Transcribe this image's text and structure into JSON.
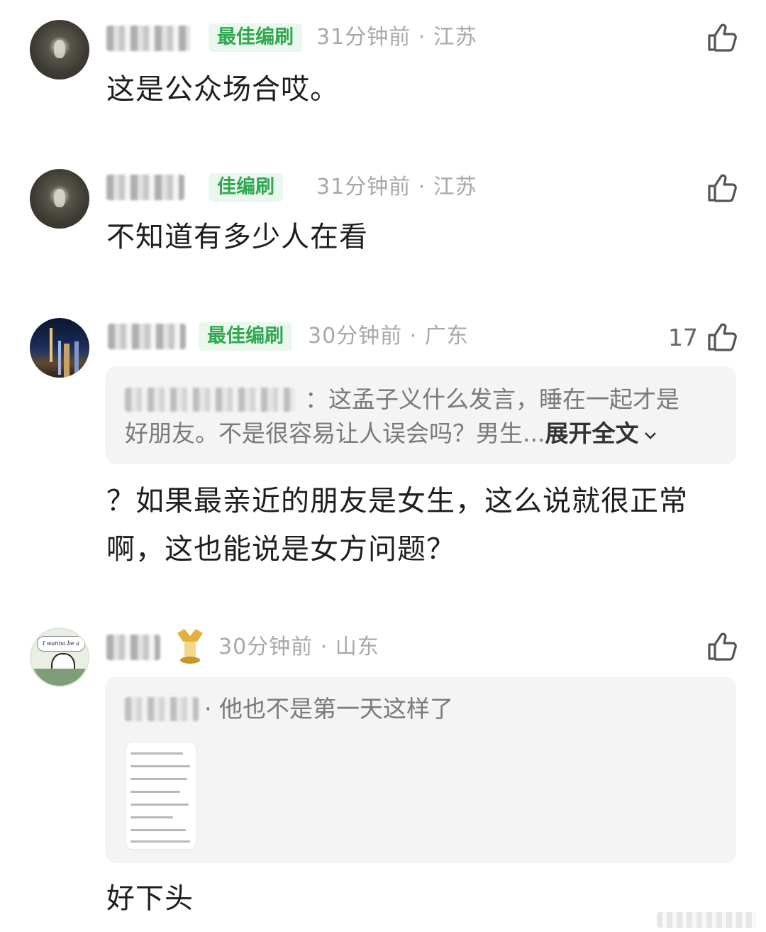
{
  "comments": [
    {
      "badge": "最佳编刷",
      "meta": "31分钟前 · 江苏",
      "text_lines": [
        "这是公众场合哎。"
      ]
    },
    {
      "badge": "佳编刷",
      "meta": "31分钟前 · 江苏",
      "text_lines": [
        "不知道有多少人在看"
      ]
    },
    {
      "badge": "最佳编刷",
      "meta": "30分钟前 · 广东",
      "like_count": "17",
      "quote_lines": [
        "：这孟子义什么发言，睡在一起才是",
        "好朋友。不是很容易让人误会吗？男生..."
      ],
      "quote_expand": "展开全文",
      "text_lines": [
        "？如果最亲近的朋友是女生，这么说就很正常",
        "啊，这也能说是女方问题？"
      ]
    },
    {
      "meta": "30分钟前 · 山东",
      "avatar_caption": "I wanna be a fish.",
      "quote_lines": [
        "·  他也不是第一天这样了"
      ],
      "text_lines": [
        "好下头"
      ]
    }
  ],
  "icons": {
    "like": "thumbs-up-icon",
    "expand": "chevron-down-icon",
    "medal": "gold-medal-icon"
  },
  "colors": {
    "badge_bg": "#eaf7ec",
    "badge_text": "#2fa84f",
    "meta": "#a8a8a8",
    "quote_bg": "#f4f4f4"
  }
}
